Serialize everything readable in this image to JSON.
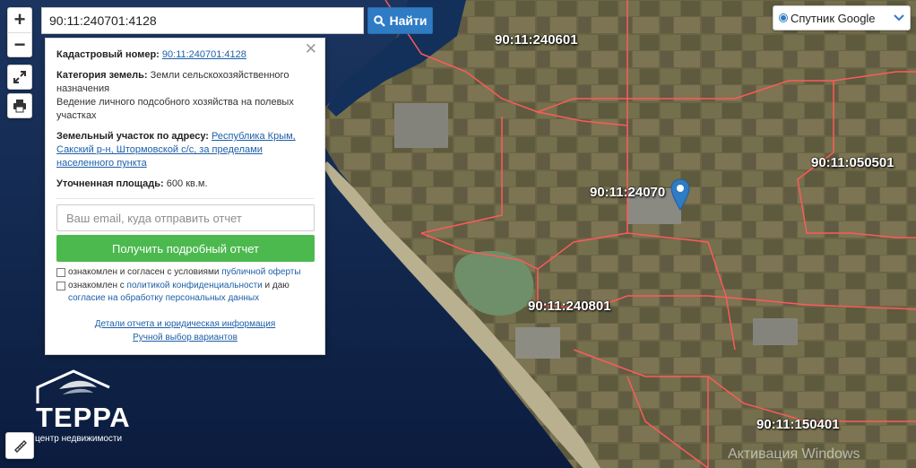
{
  "search": {
    "value": "90:11:240701:4128",
    "button_label": "Найти"
  },
  "zoom": {
    "in_label": "+",
    "out_label": "−"
  },
  "layer": {
    "selected": "Спутник Google"
  },
  "parcels": [
    {
      "label": "90:11:240601"
    },
    {
      "label": "90:11:050501"
    },
    {
      "label": "90:11:24070"
    },
    {
      "label": "90:11:240801"
    },
    {
      "label": "90:11:150401"
    }
  ],
  "info": {
    "cadastral_label": "Кадастровый номер:",
    "cadastral_value": "90:11:240701:4128",
    "category_label": "Категория земель:",
    "category_value": "Земли сельскохозяйственного назначения",
    "usage": "Ведение личного подсобного хозяйства на полевых участках",
    "address_label": "Земельный участок по адресу:",
    "address_value": "Республика Крым, Сакский р-н, Штормовской с/с, за пределами населенного пункта",
    "area_label": "Уточненная площадь:",
    "area_value": "600 кв.м."
  },
  "form": {
    "email_placeholder": "Ваш email, куда отправить отчет",
    "submit_label": "Получить подробный отчет",
    "consent1_text": "ознакомлен и согласен с условиями",
    "consent1_link": "публичной оферты",
    "consent2_text": "ознакомлен с",
    "consent2_link1": "политикой конфиденциальности",
    "consent2_mid": "и даю",
    "consent2_link2": "согласие на обработку персональных данных"
  },
  "links": {
    "details": "Детали отчета и юридическая информация",
    "manual": "Ручной выбор вариантов"
  },
  "logo": {
    "name": "ТЕРРА",
    "tagline": "центр недвижимости"
  },
  "watermark": "Активация Windows",
  "colors": {
    "accent": "#2f7bc4",
    "green": "#4cb94f",
    "parcel_border": "#ff5a5a",
    "marker": "#2f7bc4"
  }
}
